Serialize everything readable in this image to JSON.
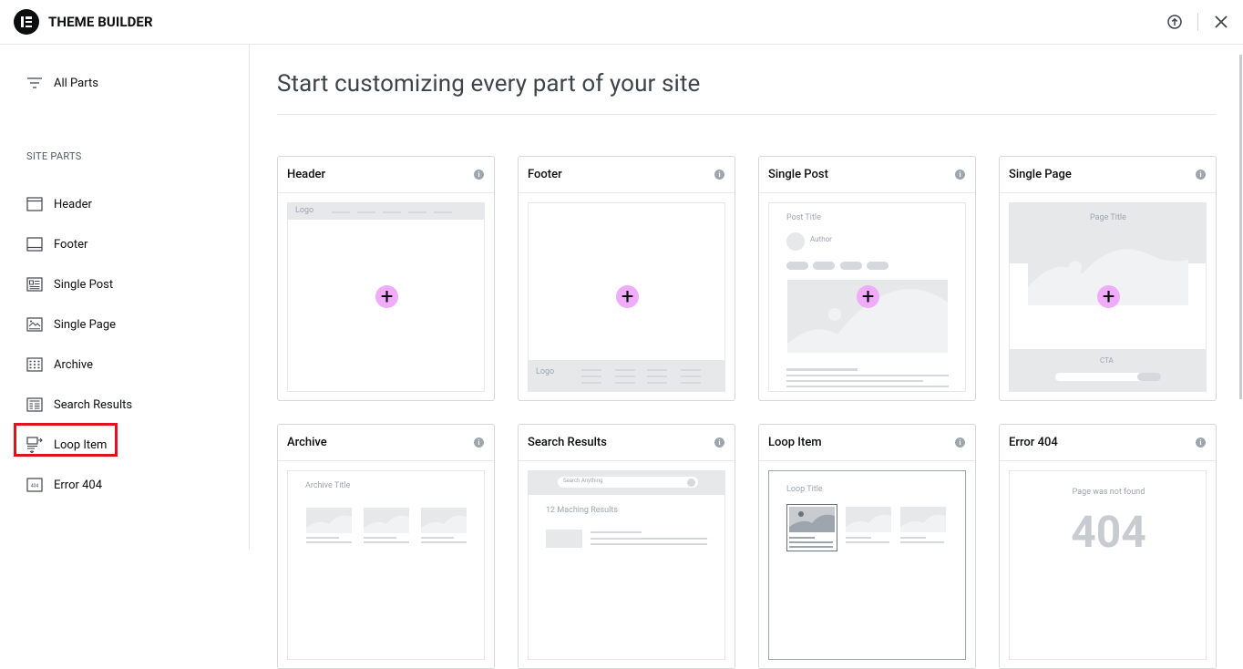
{
  "app": {
    "title": "THEME BUILDER"
  },
  "topbar": {
    "help_icon": "help-circle-icon",
    "close_icon": "close-icon"
  },
  "sidebar": {
    "all_parts_label": "All Parts",
    "section_label": "SITE PARTS",
    "items": [
      {
        "label": "Header",
        "icon": "header-icon"
      },
      {
        "label": "Footer",
        "icon": "footer-icon"
      },
      {
        "label": "Single Post",
        "icon": "single-post-icon"
      },
      {
        "label": "Single Page",
        "icon": "single-page-icon"
      },
      {
        "label": "Archive",
        "icon": "archive-icon"
      },
      {
        "label": "Search Results",
        "icon": "search-results-icon"
      },
      {
        "label": "Loop Item",
        "icon": "loop-item-icon"
      },
      {
        "label": "Error 404",
        "icon": "error-404-icon"
      }
    ]
  },
  "main": {
    "title": "Start customizing every part of your site",
    "cards": [
      {
        "title": "Header"
      },
      {
        "title": "Footer"
      },
      {
        "title": "Single Post"
      },
      {
        "title": "Single Page"
      },
      {
        "title": "Archive"
      },
      {
        "title": "Search Results"
      },
      {
        "title": "Loop Item"
      },
      {
        "title": "Error 404"
      }
    ],
    "placeholders": {
      "logo": "Logo",
      "footer_logo": "Logo",
      "post_title": "Post Title",
      "author": "Author",
      "page_title": "Page Title",
      "cta": "CTA",
      "archive_title": "Archive Title",
      "search_placeholder": "Search Anything",
      "matching_results": "12 Maching Results",
      "loop_title": "Loop Title",
      "not_found": "Page was not found",
      "error_code": "404",
      "info_glyph": "i",
      "plus_glyph": "+",
      "error_icon_text": "404"
    }
  },
  "colors": {
    "accent_plus": "#f0abfc",
    "highlight": "#e0121d",
    "text": "#0c0d0e"
  }
}
